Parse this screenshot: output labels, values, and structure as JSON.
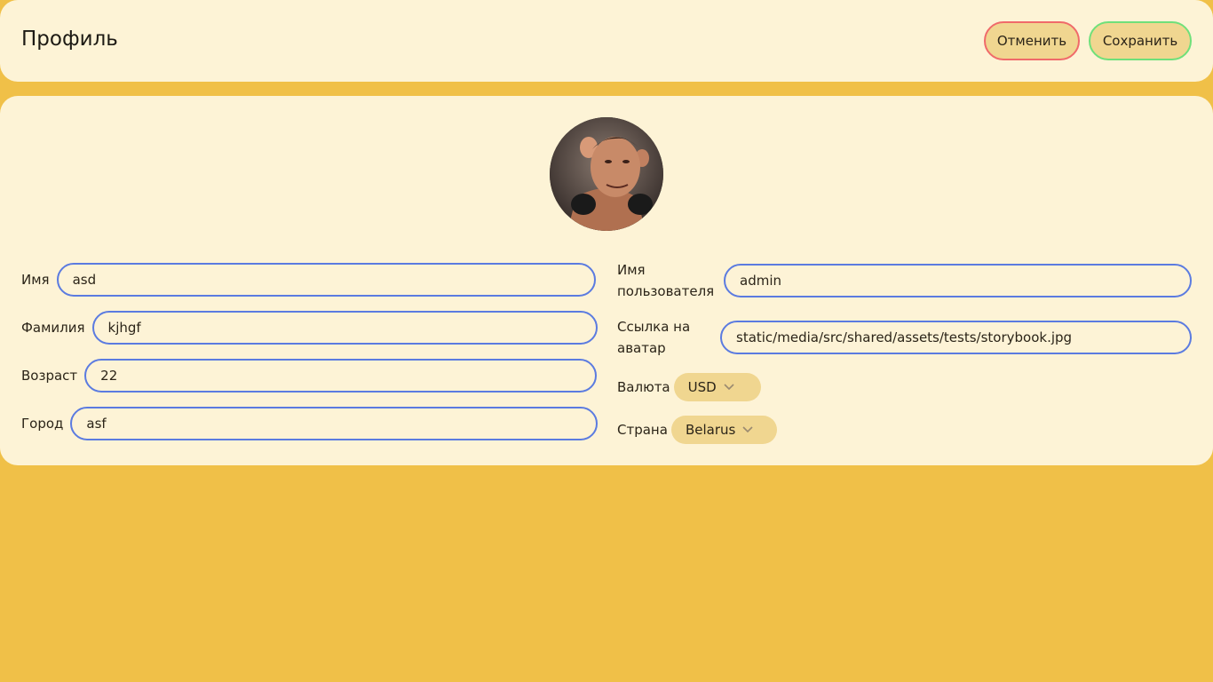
{
  "header": {
    "title": "Профиль",
    "cancel_label": "Отменить",
    "save_label": "Сохранить"
  },
  "colors": {
    "page_bg": "#f0c048",
    "card_bg": "#fdf3d6",
    "input_border": "#5b7be0",
    "cancel_border": "#f06a6a",
    "save_border": "#6fe07a",
    "button_bg": "#f0d690"
  },
  "profile": {
    "first_name": {
      "label": "Имя",
      "value": "asd"
    },
    "last_name": {
      "label": "Фамилия",
      "value": "kjhgf"
    },
    "age": {
      "label": "Возраст",
      "value": "22"
    },
    "city": {
      "label": "Город",
      "value": "asf"
    },
    "username": {
      "label_line1": "Имя",
      "label_line2": "пользователя",
      "value": "admin"
    },
    "avatar_link": {
      "label_line1": "Ссылка на",
      "label_line2": "аватар",
      "value": "static/media/src/shared/assets/tests/storybook.jpg"
    },
    "currency": {
      "label": "Валюта",
      "value": "USD"
    },
    "country": {
      "label": "Страна",
      "value": "Belarus"
    }
  }
}
